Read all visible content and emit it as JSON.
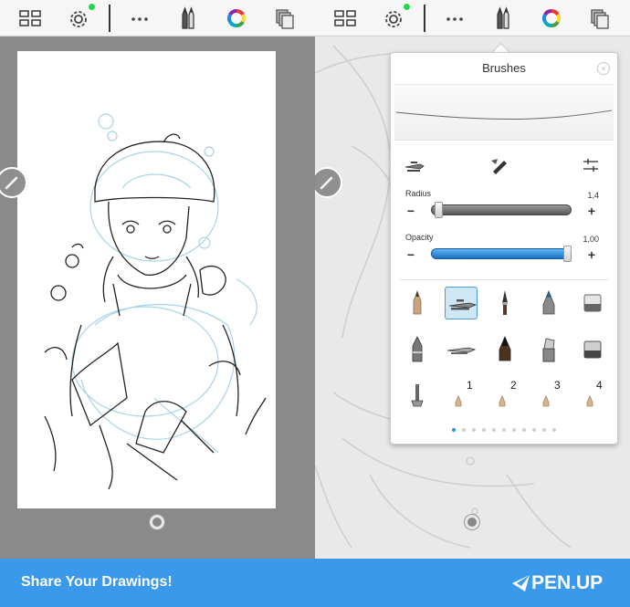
{
  "toolbar": {
    "icons": [
      "grid-icon",
      "gear-icon",
      "more-icon",
      "pencils-icon",
      "color-wheel-icon",
      "layers-icon"
    ],
    "notification_color": "#1ed84a"
  },
  "brushes_panel": {
    "title": "Brushes",
    "radius": {
      "label": "Radius",
      "value": "1,4",
      "level": 0.03
    },
    "opacity": {
      "label": "Opacity",
      "value": "1,00",
      "level": 1.0
    },
    "grid": [
      [
        "pencil-brush",
        "ballpoint-brush",
        "paintbrush-brush",
        "marker-brush",
        "eraser-brush"
      ],
      [
        "fountain-pen-brush",
        "airbrush-brush",
        "inkbrush-brush",
        "chisel-marker-brush",
        "smudge-eraser-brush"
      ],
      [
        "smear-tool-brush",
        "custom-slot-1",
        "custom-slot-2",
        "custom-slot-3",
        "custom-slot-4"
      ]
    ],
    "slot_numbers": [
      "1",
      "2",
      "3",
      "4"
    ],
    "selected_index": 1,
    "page_count": 11,
    "active_page": 0
  },
  "footer": {
    "cta": "Share Your Drawings!",
    "logo": "PEN.UP",
    "color": "#3a99ea"
  }
}
